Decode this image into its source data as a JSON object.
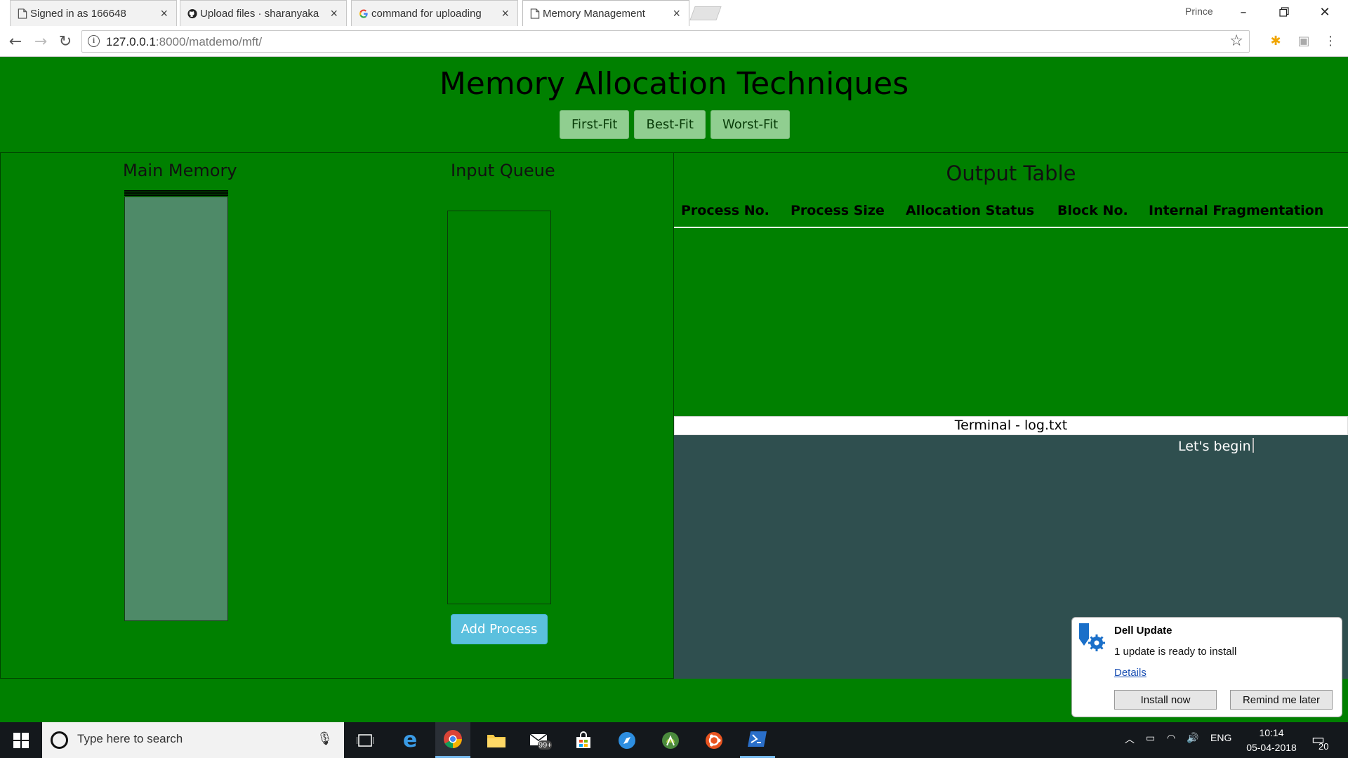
{
  "browser": {
    "tabs": [
      {
        "title": "Signed in as 166648",
        "icon": "document-icon"
      },
      {
        "title": "Upload files · sharanyaka",
        "icon": "github-icon"
      },
      {
        "title": "command for uploading",
        "icon": "google-icon"
      },
      {
        "title": "Memory Management",
        "icon": "document-icon",
        "active": true
      }
    ],
    "profile": "Prince",
    "url_host": "127.0.0.1",
    "url_path": ":8000/matdemo/mft/"
  },
  "page": {
    "title": "Memory Allocation Techniques",
    "algorithms": [
      "First-Fit",
      "Best-Fit",
      "Worst-Fit"
    ],
    "main_memory_label": "Main Memory",
    "input_queue_label": "Input Queue",
    "add_process_label": "Add Process",
    "output_table": {
      "title": "Output Table",
      "columns": [
        "Process No.",
        "Process Size",
        "Allocation Status",
        "Block No.",
        "Internal Fragmentation"
      ],
      "rows": []
    },
    "terminal": {
      "title": "Terminal - log.txt",
      "line": "Let's begin"
    },
    "colors": {
      "page_bg": "#008000",
      "memory_fill": "#4e8a68",
      "terminal_bg": "#2f4f4f",
      "algo_button": "#90ce90",
      "add_button": "#5bc0de"
    }
  },
  "toast": {
    "title": "Dell Update",
    "message": "1 update is ready to install",
    "link": "Details",
    "install_label": "Install now",
    "remind_label": "Remind me later"
  },
  "taskbar": {
    "search_placeholder": "Type here to search",
    "mail_badge": "99+",
    "language": "ENG",
    "time": "10:14",
    "date": "05-04-2018",
    "notifications": "20"
  }
}
